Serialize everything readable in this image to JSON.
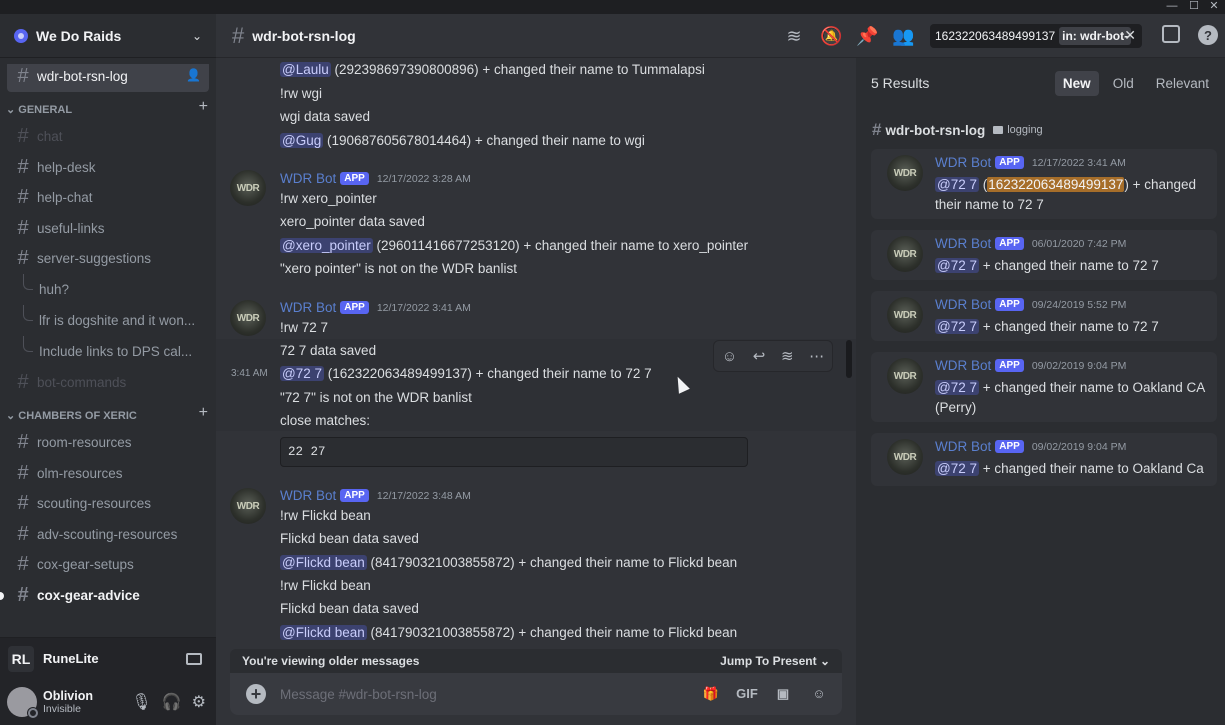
{
  "window": {
    "minimize": "—",
    "maximize": "☐",
    "close": "✕"
  },
  "server": {
    "name": "We Do Raids"
  },
  "sidebar": {
    "active_channel": "wdr-bot-rsn-log",
    "categories": [
      {
        "name": "GENERAL"
      },
      {
        "name": "CHAMBERS OF XERIC"
      }
    ],
    "general_channels": [
      {
        "label": "chat"
      },
      {
        "label": "help-desk"
      },
      {
        "label": "help-chat"
      },
      {
        "label": "useful-links"
      },
      {
        "label": "server-suggestions"
      }
    ],
    "threads": [
      {
        "label": "huh?"
      },
      {
        "label": "lfr is dogshite and it won..."
      },
      {
        "label": "Include links to DPS cal..."
      }
    ],
    "muted_channel": "bot-commands",
    "cox_channels": [
      {
        "label": "room-resources"
      },
      {
        "label": "olm-resources"
      },
      {
        "label": "scouting-resources"
      },
      {
        "label": "adv-scouting-resources"
      },
      {
        "label": "cox-gear-setups"
      },
      {
        "label": "cox-gear-advice"
      }
    ],
    "runelite": {
      "logo": "RL",
      "name": "RuneLite"
    },
    "user": {
      "name": "Oblivion",
      "status": "Invisible"
    }
  },
  "header": {
    "channel": "wdr-bot-rsn-log",
    "search_query": "162322063489499137",
    "search_filter": "in: wdr-bot-"
  },
  "chat": {
    "top_lines": [
      {
        "mention": "@Laulu",
        "text": " (292398697390800896) + changed their name to Tummalapsi"
      },
      {
        "text": "!rw wgi"
      },
      {
        "text": "wgi data saved"
      },
      {
        "mention": "@Gug",
        "text": " (190687605678014464) + changed their name to wgi"
      }
    ],
    "messages": [
      {
        "author": "WDR Bot",
        "tag": "APP",
        "time": "12/17/2022 3:28 AM",
        "lines": [
          {
            "text": "!rw xero_pointer"
          },
          {
            "text": "xero_pointer data saved"
          },
          {
            "mention": "@xero_pointer",
            "text": " (296011416677253120) + changed their name to xero_pointer"
          },
          {
            "text": "\"xero pointer\" is not on the WDR banlist"
          }
        ]
      },
      {
        "author": "WDR Bot",
        "tag": "APP",
        "time": "12/17/2022 3:41 AM",
        "side_time": "3:41 AM",
        "lines": [
          {
            "text": "!rw 72 7"
          },
          {
            "text": "72 7 data saved"
          },
          {
            "mention": "@72 7",
            "text": " (162322063489499137) + changed their name to 72 7"
          },
          {
            "text": "\"72 7\" is not on the WDR banlist"
          },
          {
            "text": "close matches:"
          }
        ],
        "code": "22  27"
      },
      {
        "author": "WDR Bot",
        "tag": "APP",
        "time": "12/17/2022 3:48 AM",
        "lines": [
          {
            "text": "!rw Flickd bean"
          },
          {
            "text": "Flickd bean data saved"
          },
          {
            "mention": "@Flickd bean",
            "text": " (841790321003855872) + changed their name to Flickd bean"
          },
          {
            "text": "!rw Flickd bean"
          },
          {
            "text": "Flickd bean data saved"
          },
          {
            "mention": "@Flickd bean",
            "text": " (841790321003855872) + changed their name to Flickd bean"
          }
        ]
      }
    ],
    "older_notice": "You're viewing older messages",
    "jump_label": "Jump To Present",
    "composer_placeholder": "Message #wdr-bot-rsn-log",
    "gif_label": "GIF"
  },
  "results": {
    "count": "5 Results",
    "tabs": [
      "New",
      "Old",
      "Relevant"
    ],
    "channel": "wdr-bot-rsn-log",
    "category": "logging",
    "items": [
      {
        "author": "WDR Bot",
        "tag": "APP",
        "time": "12/17/2022 3:41 AM",
        "mention": "@72 7",
        "pre": " (",
        "highlight": "162322063489499137",
        "post": ") + changed their name to 72 7"
      },
      {
        "author": "WDR Bot",
        "tag": "APP",
        "time": "06/01/2020 7:42 PM",
        "mention": "@72 7",
        "post": " + changed their name to 72 7"
      },
      {
        "author": "WDR Bot",
        "tag": "APP",
        "time": "09/24/2019 5:52 PM",
        "mention": "@72 7",
        "post": " + changed their name to 72 7"
      },
      {
        "author": "WDR Bot",
        "tag": "APP",
        "time": "09/02/2019 9:04 PM",
        "mention": "@72 7",
        "post": " + changed their name to Oakland CA (Perry)"
      },
      {
        "author": "WDR Bot",
        "tag": "APP",
        "time": "09/02/2019 9:04 PM",
        "mention": "@72 7",
        "post": " + changed their name to Oakland Ca"
      }
    ]
  }
}
